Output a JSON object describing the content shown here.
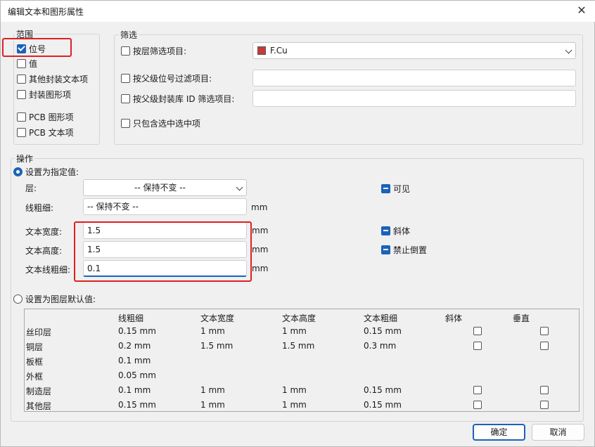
{
  "window": {
    "title": "编辑文本和图形属性",
    "close_glyph": "✕"
  },
  "scope": {
    "label": "范围",
    "items": [
      {
        "label": "位号",
        "checked": true
      },
      {
        "label": "值",
        "checked": false
      },
      {
        "label": "其他封装文本项",
        "checked": false
      },
      {
        "label": "封装图形项",
        "checked": false
      },
      {
        "label": "PCB 图形项",
        "checked": false
      },
      {
        "label": "PCB 文本项",
        "checked": false
      }
    ]
  },
  "filter": {
    "label": "筛选",
    "by_layer": {
      "label": "按层筛选项目:",
      "layer_value": "F.Cu",
      "layer_color": "#c8393a"
    },
    "by_parent_ref": {
      "label": "按父级位号过滤项目:",
      "value": ""
    },
    "by_parent_fpid": {
      "label": "按父级封装库 ID 筛选项目:",
      "value": ""
    },
    "selected_only": {
      "label": "只包含选中选中项"
    }
  },
  "actions": {
    "label": "操作",
    "set_specified": {
      "label": "设置为指定值:"
    },
    "layer": {
      "label": "层:",
      "value": "-- 保持不变 --"
    },
    "line_width": {
      "label": "线粗细:",
      "value": "-- 保持不变 --",
      "unit": "mm"
    },
    "text_width": {
      "label": "文本宽度:",
      "value": "1.5",
      "unit": "mm"
    },
    "text_height": {
      "label": "文本高度:",
      "value": "1.5",
      "unit": "mm"
    },
    "text_thickness": {
      "label": "文本线粗细:",
      "value": "0.1",
      "unit": "mm"
    },
    "visible": {
      "label": "可见"
    },
    "italic": {
      "label": "斜体"
    },
    "keep_upright": {
      "label": "禁止倒置"
    },
    "set_defaults": {
      "label": "设置为图层默认值:"
    }
  },
  "defaults_table": {
    "headers": [
      "线粗细",
      "文本宽度",
      "文本高度",
      "文本粗细",
      "斜体",
      "垂直"
    ],
    "rows": [
      {
        "layer": "丝印层",
        "line": "0.15 mm",
        "width": "1 mm",
        "height": "1 mm",
        "thick": "0.15 mm",
        "has_checks": true
      },
      {
        "layer": "铜层",
        "line": "0.2 mm",
        "width": "1.5 mm",
        "height": "1.5 mm",
        "thick": "0.3 mm",
        "has_checks": true
      },
      {
        "layer": "板框",
        "line": "0.1 mm",
        "width": "",
        "height": "",
        "thick": "",
        "has_checks": false
      },
      {
        "layer": "外框",
        "line": "0.05 mm",
        "width": "",
        "height": "",
        "thick": "",
        "has_checks": false
      },
      {
        "layer": "制造层",
        "line": "0.1 mm",
        "width": "1 mm",
        "height": "1 mm",
        "thick": "0.15 mm",
        "has_checks": true
      },
      {
        "layer": "其他层",
        "line": "0.15 mm",
        "width": "1 mm",
        "height": "1 mm",
        "thick": "0.15 mm",
        "has_checks": true
      }
    ]
  },
  "buttons": {
    "ok": "确定",
    "cancel": "取消"
  }
}
